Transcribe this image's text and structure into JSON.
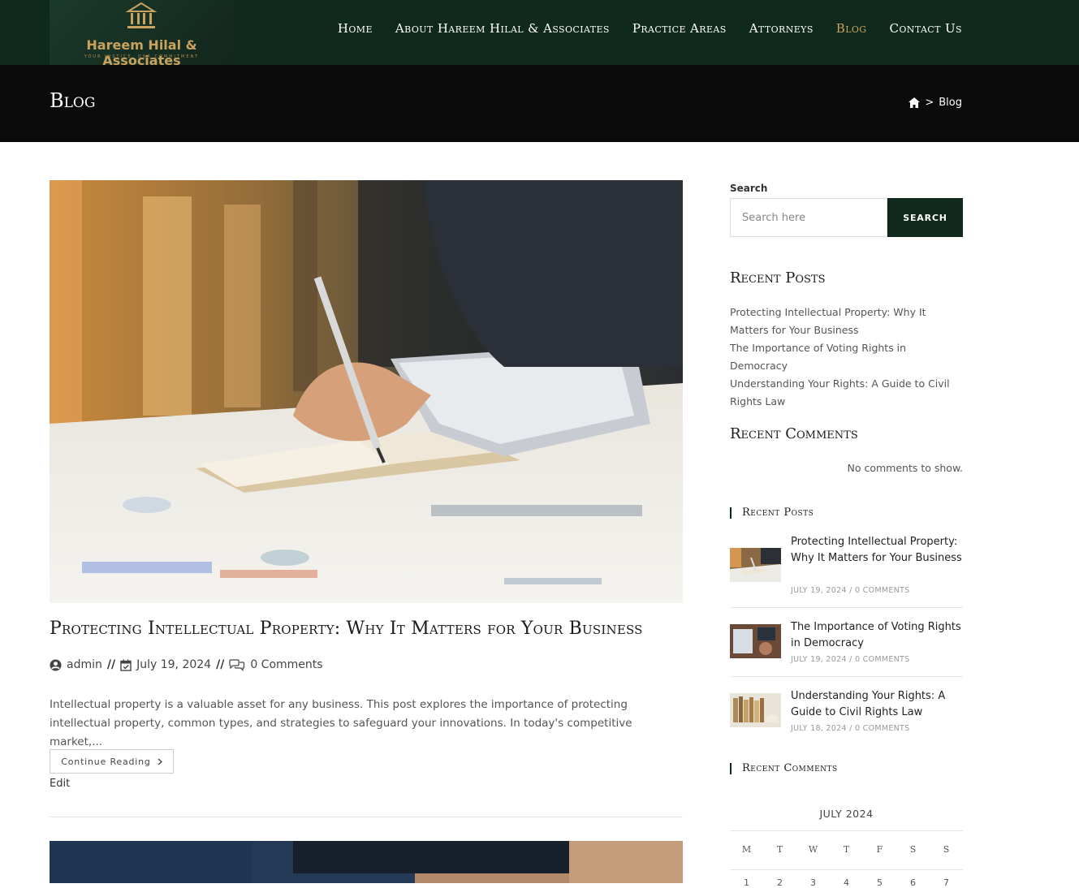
{
  "brand": {
    "name": "Hareem Hilal & Associates",
    "tagline": "YOUR JUSTICE, OUR COMMITMENT"
  },
  "nav": {
    "items": [
      {
        "label": "Home"
      },
      {
        "label": "About Hareem Hilal & Associates"
      },
      {
        "label": "Practice Areas"
      },
      {
        "label": "Attorneys"
      },
      {
        "label": "Blog",
        "active": true
      },
      {
        "label": "Contact Us"
      }
    ]
  },
  "page": {
    "title": "Blog",
    "breadcrumb_current": "Blog"
  },
  "post": {
    "title": "Protecting Intellectual Property: Why It Matters for Your Business",
    "author": "admin",
    "date": "July 19, 2024",
    "comments": "0 Comments",
    "excerpt": "Intellectual property is a valuable asset for any business. This post explores the importance of protecting intellectual property, common types, and strategies to safeguard your innovations. In today's competitive market,...",
    "read_more": "Continue Reading",
    "edit": "Edit"
  },
  "sidebar": {
    "search_label": "Search",
    "search_placeholder": "Search here",
    "search_button": "SEARCH",
    "recent_posts_heading": "Recent Posts",
    "recent_posts": [
      "Protecting Intellectual Property: Why It Matters for Your Business",
      "The Importance of Voting Rights in Democracy",
      "Understanding Your Rights: A Guide to Civil Rights Law"
    ],
    "recent_comments_heading": "Recent Comments",
    "no_comments": "No comments to show.",
    "recent_posts_heading_2": "Recent Posts",
    "thumb_posts": [
      {
        "title": "Protecting Intellectual Property: Why It Matters for Your Business",
        "date": "JULY 19, 2024 /",
        "comments": "0 COMMENTS"
      },
      {
        "title": "The Importance of Voting Rights in Democracy",
        "date": "JULY 19, 2024 /",
        "comments": "0 COMMENTS"
      },
      {
        "title": "Understanding Your Rights: A Guide to Civil Rights Law",
        "date": "JULY 18, 2024 /",
        "comments": "0 COMMENTS"
      }
    ],
    "recent_comments_heading_2": "Recent Comments",
    "calendar": {
      "caption": "JULY 2024",
      "weekdays": [
        "M",
        "T",
        "W",
        "T",
        "F",
        "S",
        "S"
      ],
      "first_row": [
        "1",
        "2",
        "3",
        "4",
        "5",
        "6",
        "7"
      ]
    }
  },
  "colors": {
    "header_bg": "#0f2a1c",
    "title_bar_bg": "#0b0b0b",
    "accent_gold": "#c9a25e",
    "button_bg": "#0f2a1c"
  }
}
